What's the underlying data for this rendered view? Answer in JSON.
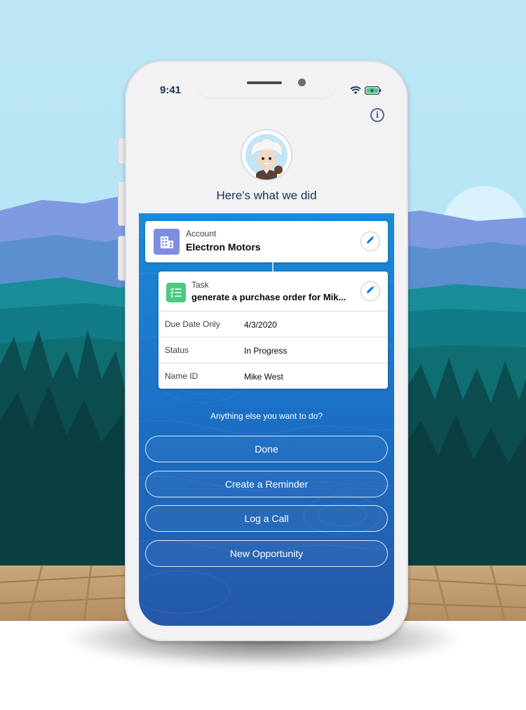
{
  "status_bar": {
    "time": "9:41"
  },
  "headline": "Here's what we did",
  "account_card": {
    "label": "Account",
    "value": "Electron Motors"
  },
  "task_card": {
    "label": "Task",
    "value": "generate a purchase order for Mik...",
    "fields": [
      {
        "key": "Due Date Only",
        "value": "4/3/2020"
      },
      {
        "key": "Status",
        "value": "In Progress"
      },
      {
        "key": "Name ID",
        "value": "Mike West"
      }
    ]
  },
  "prompt": "Anything else you want to do?",
  "actions": [
    {
      "label": "Done"
    },
    {
      "label": "Create a Reminder"
    },
    {
      "label": "Log a Call"
    },
    {
      "label": "New Opportunity"
    }
  ],
  "icons": {
    "info": "info-icon",
    "avatar": "einstein-avatar",
    "account": "building-icon",
    "task": "task-checklist-icon",
    "edit": "pencil-icon",
    "wifi": "wifi-icon",
    "battery": "battery-charging-icon"
  },
  "colors": {
    "panel_top": "#1b8ad8",
    "panel_bottom": "#2658a8",
    "account_icon": "#7f8de1",
    "task_icon": "#4bca81",
    "title_text": "#16325c"
  },
  "info_glyph": "i"
}
